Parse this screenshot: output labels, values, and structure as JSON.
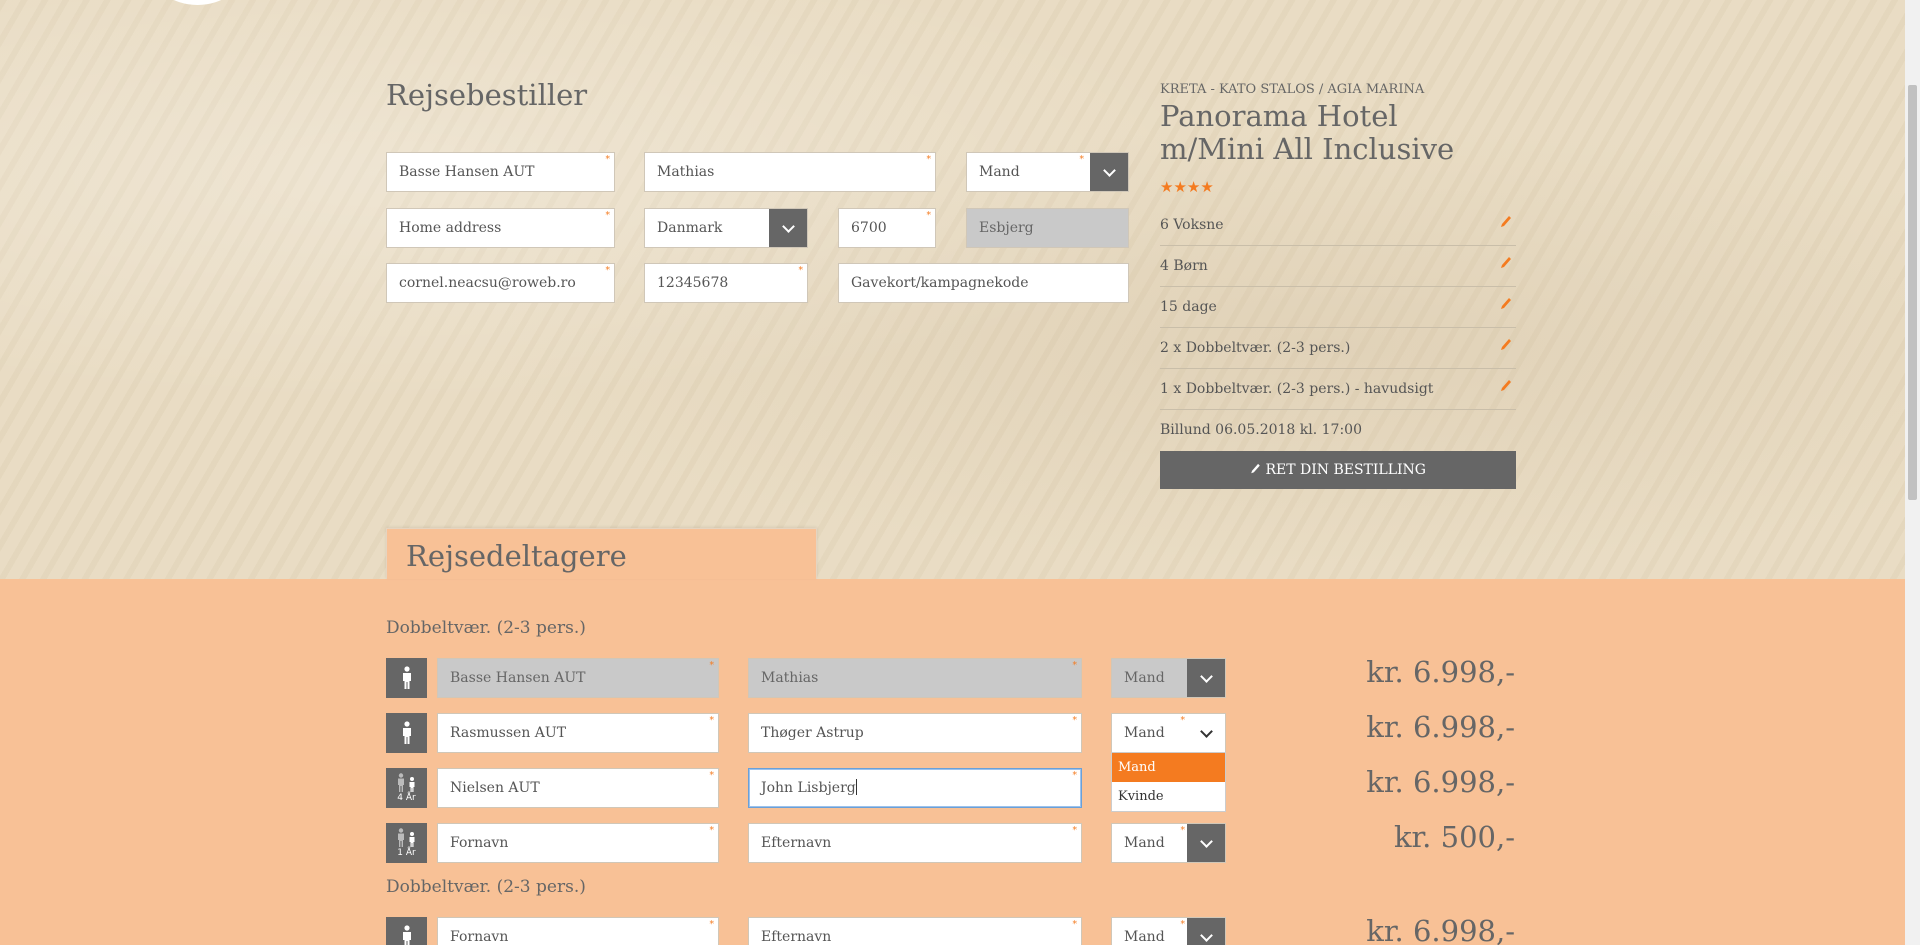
{
  "booker": {
    "title": "Rejsebestiller",
    "last_name": "Basse Hansen AUT",
    "first_name": "Mathias",
    "gender": "Mand",
    "address_placeholder": "Home address",
    "country": "Danmark",
    "zip": "6700",
    "city": "Esbjerg",
    "email": "cornel.neacsu@roweb.ro",
    "phone": "12345678",
    "voucher_placeholder": "Gavekort/kampagnekode",
    "required_mark": "*"
  },
  "summary": {
    "destination": "KRETA - KATO STALOS / AGIA MARINA",
    "hotel": "Panorama Hotel m/Mini All Inclusive",
    "stars": "★★★★",
    "rows": [
      {
        "label": "6 Voksne"
      },
      {
        "label": "4 Børn"
      },
      {
        "label": "15 dage"
      },
      {
        "label": "2 x Dobbeltvær. (2-3 pers.)"
      },
      {
        "label": "1 x Dobbeltvær. (2-3 pers.) - havudsigt"
      }
    ],
    "departure": "Billund 06.05.2018 kl. 17:00",
    "edit_button": "RET DIN BESTILLING"
  },
  "participants": {
    "title": "Rejsedeltagere",
    "groups": [
      {
        "label": "Dobbeltvær. (2-3 pers.)",
        "rows": [
          {
            "icon": "adult",
            "last": "Basse Hansen AUT",
            "first": "Mathias",
            "gender": "Mand",
            "price": "kr. 6.998,-"
          },
          {
            "icon": "adult",
            "last": "Rasmussen AUT",
            "first": "Thøger Astrup",
            "gender": "Mand",
            "price": "kr. 6.998,-"
          },
          {
            "icon": "child",
            "age": "4 År",
            "last": "Nielsen AUT",
            "first": "John Lisbjerg",
            "gender": "",
            "price": "kr. 6.998,-"
          },
          {
            "icon": "child",
            "age": "1 År",
            "last_placeholder": "Fornavn",
            "first_placeholder": "Efternavn",
            "gender": "Mand",
            "price": "kr. 500,-"
          }
        ]
      },
      {
        "label": "Dobbeltvær. (2-3 pers.)",
        "rows": [
          {
            "icon": "adult",
            "last_placeholder": "Fornavn",
            "first_placeholder": "Efternavn",
            "gender": "Mand",
            "price": "kr. 6.998,-"
          }
        ]
      }
    ],
    "gender_options": [
      "Mand",
      "Kvinde"
    ]
  },
  "colors": {
    "accent": "#f47b20",
    "peach": "#f8c196",
    "dark_button": "#666666"
  }
}
